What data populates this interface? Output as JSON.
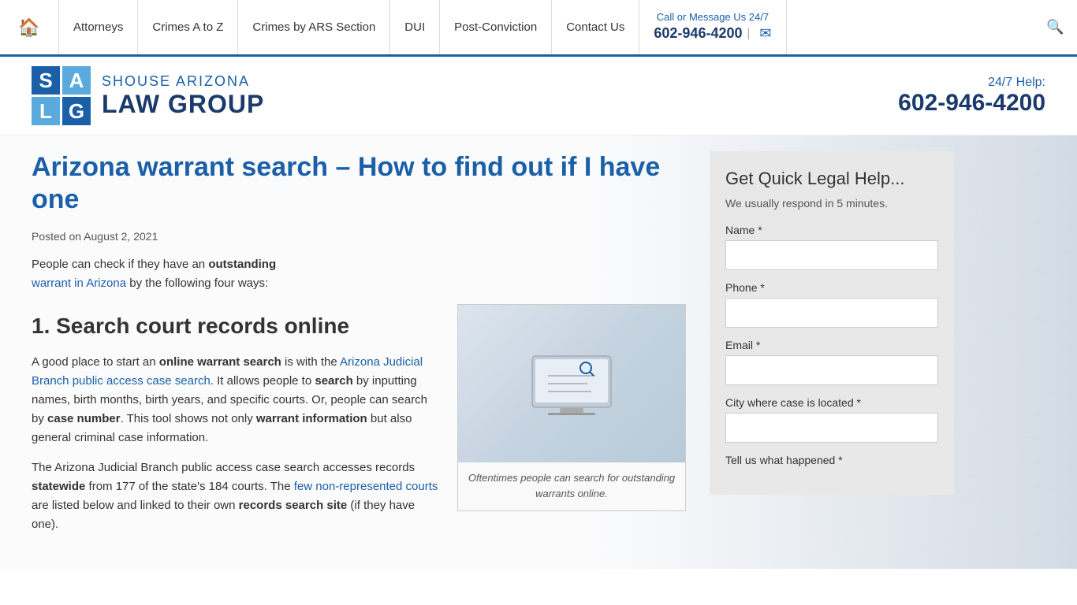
{
  "nav": {
    "home_icon": "🏠",
    "items": [
      {
        "label": "Attorneys",
        "name": "nav-attorneys"
      },
      {
        "label": "Crimes A to Z",
        "name": "nav-crimes-az"
      },
      {
        "label": "Crimes by ARS Section",
        "name": "nav-crimes-ars"
      },
      {
        "label": "DUI",
        "name": "nav-dui"
      },
      {
        "label": "Post-Conviction",
        "name": "nav-post-conviction"
      },
      {
        "label": "Contact Us",
        "name": "nav-contact"
      }
    ],
    "call_label": "Call or Message Us 24/7",
    "phone": "602-946-4200",
    "search_icon": "🔍"
  },
  "header": {
    "logo": {
      "s": "S",
      "a": "A",
      "l": "L",
      "g": "G",
      "top": "SHOUSE  ARIZONA",
      "bottom": "LAW GROUP"
    },
    "help_label": "24/7 Help:",
    "phone": "602-946-4200"
  },
  "article": {
    "title": "Arizona warrant search – How to find out if I have one",
    "posted": "Posted on August 2, 2021",
    "intro_text": "People can check if they have an ",
    "intro_bold": "outstanding",
    "intro_link": "warrant in Arizona",
    "intro_rest": " by the following four ways:",
    "section1_heading": "1. Search court records online",
    "para1_start": "A good place to start an ",
    "para1_bold": "online warrant search",
    "para1_mid": " is with the ",
    "para1_link": "Arizona Judicial Branch public access case search",
    "para1_rest": ". It allows people to ",
    "para1_bold2": "search",
    "para1_rest2": " by inputting names, birth months, birth years, and specific courts. Or, people can search by ",
    "para1_bold3": "case number",
    "para1_rest3": ". This tool shows not only ",
    "para1_bold4": "warrant information",
    "para1_rest4": " but also general criminal case information.",
    "para2_start": "The Arizona Judicial Branch public access case search accesses records ",
    "para2_bold": "statewide",
    "para2_mid": " from 177 of the state's 184 courts. The ",
    "para2_link": "few non-represented courts",
    "para2_rest": " are listed below and linked to their own ",
    "para2_bold2": "records search site",
    "para2_rest2": " (if they have one).",
    "img_caption": "Oftentimes people can search for outstanding warrants online."
  },
  "sidebar": {
    "title": "Get Quick Legal Help...",
    "respond_text": "We usually respond in 5 minutes.",
    "fields": [
      {
        "label": "Name *",
        "name": "name-field"
      },
      {
        "label": "Phone *",
        "name": "phone-field"
      },
      {
        "label": "Email *",
        "name": "email-field"
      },
      {
        "label": "City where case is located *",
        "name": "city-field"
      }
    ],
    "tell_us_label": "Tell us what happened *"
  },
  "colors": {
    "primary_blue": "#1a5fa8",
    "dark_blue": "#1a3a6b",
    "link_blue": "#1a5fa8"
  }
}
